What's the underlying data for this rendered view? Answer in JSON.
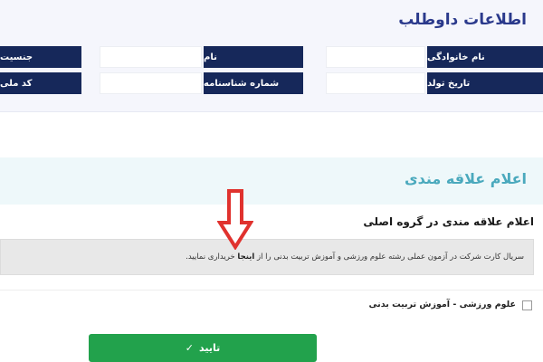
{
  "candidate_info": {
    "title": "اطلاعات داوطلب",
    "fields": [
      {
        "label": "نام خانوادگی",
        "value": ""
      },
      {
        "label": "نام",
        "value": ""
      },
      {
        "label": "جنسیت",
        "value": ""
      },
      {
        "label": "تاریخ تولد",
        "value": ""
      },
      {
        "label": "شماره شناسنامه",
        "value": ""
      },
      {
        "label": "کد ملی",
        "value": ""
      }
    ]
  },
  "interest": {
    "title": "اعلام علاقه مندی",
    "group_title": "اعلام علاقه مندی در گروه اصلی",
    "notice_before": "سریال کارت شرکت در آزمون عملی رشته علوم ورزشی و آموزش تربیت بدنی را از",
    "notice_link": "اینجا",
    "notice_after": "خریداری نمایید.",
    "option_label": "علوم ورزشی - آموزش تربیت بدنی",
    "option_checked": false
  },
  "submit": {
    "label": "تایید",
    "icon": "check-icon"
  },
  "annotation": {
    "icon": "down-arrow-icon",
    "color": "#e0322e"
  },
  "colors": {
    "label_bg": "#16285a",
    "section_title": "#2b3a8c",
    "interest_title": "#4aa9bd",
    "submit_bg": "#22a24c"
  }
}
